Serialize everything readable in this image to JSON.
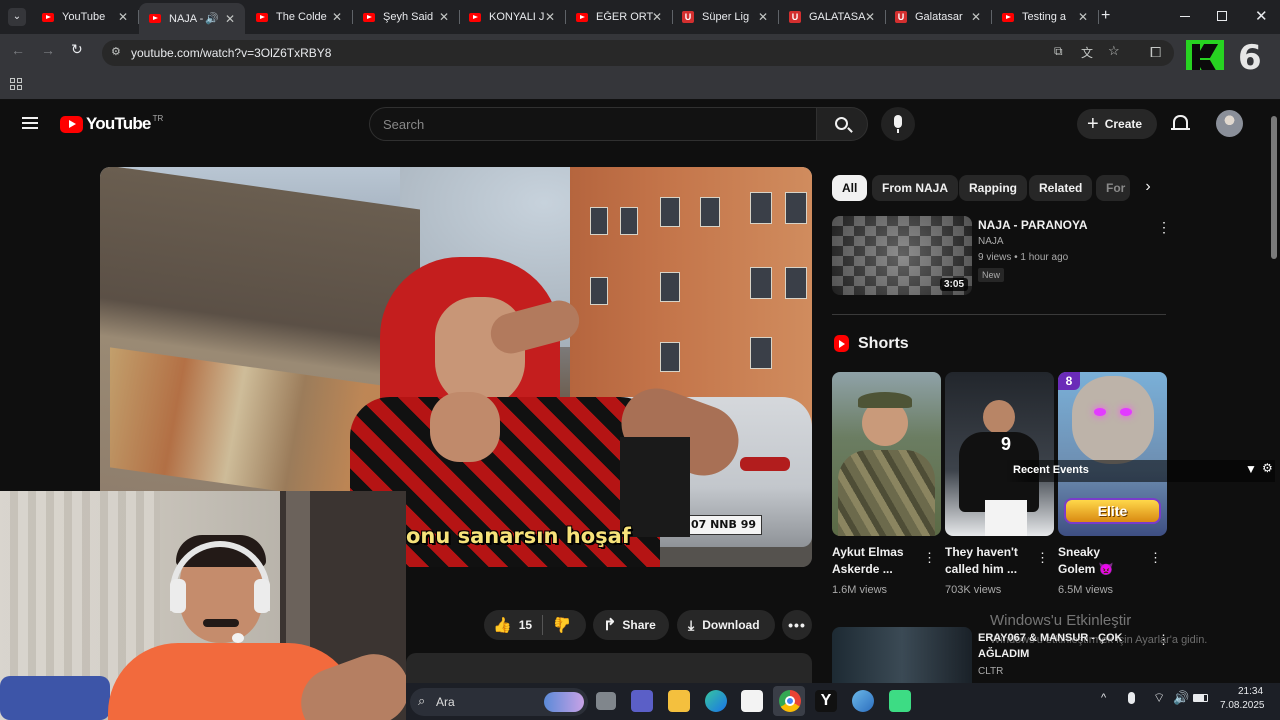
{
  "browser": {
    "tabs": [
      {
        "title": "YouTube",
        "icon": "youtube-icon"
      },
      {
        "title": "NAJA - ",
        "icon": "youtube-icon",
        "active": true
      },
      {
        "title": "The Colde",
        "icon": "youtube-icon"
      },
      {
        "title": "Şeyh Said",
        "icon": "youtube-icon"
      },
      {
        "title": "KONYALI J",
        "icon": "youtube-icon"
      },
      {
        "title": "EĞER ORT",
        "icon": "youtube-icon"
      },
      {
        "title": "Süper Lig",
        "icon": "u-icon"
      },
      {
        "title": "GALATASA",
        "icon": "u-icon"
      },
      {
        "title": "Galatasar",
        "icon": "u-icon"
      },
      {
        "title": "Testing a",
        "icon": "youtube-icon"
      }
    ],
    "url": "youtube.com/watch?v=3OlZ6TxRBY8",
    "overlay_logo": "6"
  },
  "youtube": {
    "logo_text": "YouTube",
    "region": "TR",
    "search_placeholder": "Search",
    "create_label": "Create",
    "chips": [
      "All",
      "From NAJA",
      "Rapping",
      "Related",
      "For"
    ],
    "video": {
      "subtitle": "onu sanarsın hoşaf",
      "plate": "07 NNB 99",
      "likes": "15",
      "share_label": "Share",
      "download_label": "Download"
    },
    "recommended": [
      {
        "title": "NAJA - PARANOYA",
        "channel": "NAJA",
        "meta": "9 views • 1 hour ago",
        "badge": "New",
        "duration": "3:05"
      }
    ],
    "shorts_heading": "Shorts",
    "shorts": [
      {
        "title": "Aykut Elmas Askerde ...",
        "views": "1.6M views"
      },
      {
        "title": "They haven't called him ...",
        "views": "703K views"
      },
      {
        "title": "Sneaky Golem 👿",
        "views": "6.5M views"
      }
    ],
    "shorts_overlay": {
      "recent_events": "Recent Events",
      "badge_num": "8",
      "elite": "Elite"
    },
    "next_video": {
      "title": "ERAY067 & MANSUR - ÇOK AĞLADIM",
      "channel": "CLTR"
    }
  },
  "watermark": {
    "line1": "Windows'u Etkinleştir",
    "line2": "Windows'u etkinleştirmek için Ayarlar'a gidin."
  },
  "taskbar": {
    "search": "Ara",
    "time": "21:34",
    "date": "7.08.2025"
  }
}
